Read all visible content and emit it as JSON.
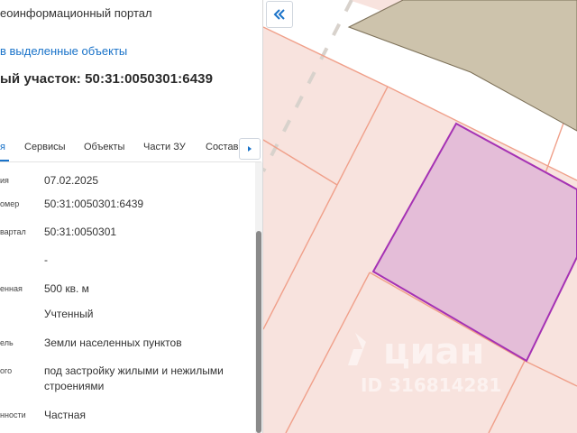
{
  "header": {
    "portal_title": "еоинформационный портал",
    "back_link": "в выделенные объекты",
    "parcel_title": "ый участок: 50:31:0050301:6439"
  },
  "tabs": [
    {
      "label": "я",
      "active": true
    },
    {
      "label": "Сервисы",
      "active": false
    },
    {
      "label": "Объекты",
      "active": false
    },
    {
      "label": "Части ЗУ",
      "active": false
    },
    {
      "label": "Состав",
      "active": false
    }
  ],
  "attributes": [
    {
      "label": "ия",
      "value": "07.02.2025"
    },
    {
      "label": "омер",
      "value": "50:31:0050301:6439"
    },
    {
      "label": "вартал",
      "value": "50:31:0050301"
    },
    {
      "label": "",
      "value": "-"
    },
    {
      "label": "енная",
      "value": "500 кв. м"
    },
    {
      "label": "",
      "value": "Учтенный"
    },
    {
      "label": "ель",
      "value": "Земли населенных пунктов"
    },
    {
      "label": "ого",
      "value": "под застройку жилыми и нежилыми строениями"
    },
    {
      "label": "нности",
      "value": "Частная"
    }
  ],
  "map": {
    "watermark_brand": "циан",
    "watermark_id": "ID 316814281",
    "colors": {
      "parcel_fill": "#f8e3de",
      "parcel_border": "#f0a08a",
      "selected_fill": "#e4bdd8",
      "selected_border": "#a532b4",
      "building_fill": "#cdc3ac"
    }
  },
  "icons": {
    "collapse": "double-chevron-left-icon",
    "tab_next": "triangle-right-icon"
  }
}
